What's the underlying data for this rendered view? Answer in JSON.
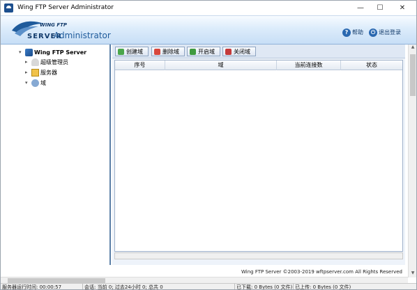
{
  "window": {
    "title": "Wing FTP Server Administrator",
    "controls": {
      "minimize": "—",
      "maximize": "☐",
      "close": "✕"
    }
  },
  "banner": {
    "logo_wing": "WING FTP",
    "logo_server": "SERVER",
    "logo_admin": "Administrator",
    "help_label": "帮助",
    "logout_label": "退出登录",
    "accent_color": "#1f5b9b"
  },
  "tree": {
    "root": "Wing FTP Server",
    "items": [
      {
        "label": "超级管理员",
        "icon": "admin-icon"
      },
      {
        "label": "服务器",
        "icon": "services-icon"
      },
      {
        "label": "域",
        "icon": "domain-icon"
      }
    ]
  },
  "toolbar": {
    "create": "创建域",
    "delete": "删除域",
    "start": "开启域",
    "stop": "关闭域"
  },
  "table": {
    "columns": [
      "序号",
      "域",
      "当前连接数",
      "状态"
    ],
    "rows": []
  },
  "footer": {
    "copyright": "Wing FTP Server ©2003-2019 wftpserver.com All Rights Reserved"
  },
  "status": {
    "uptime": "服务器运行时间: 00:00:57",
    "sessions": "会话: 当前 0; 过去24小时 0; 总共 0",
    "downloaded": "已下载: 0 Bytes (0 文件)",
    "uploaded": "已上传: 0 Bytes (0 文件)"
  }
}
